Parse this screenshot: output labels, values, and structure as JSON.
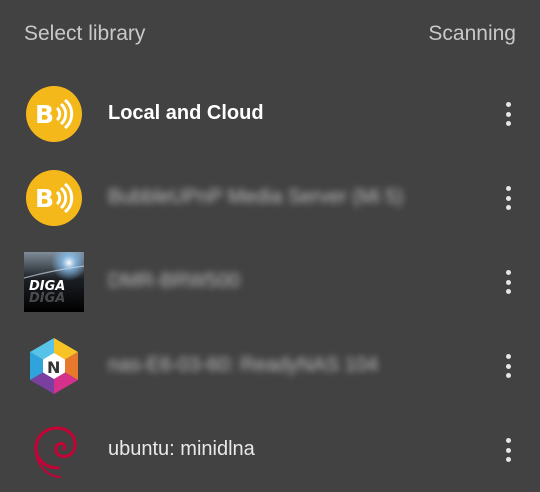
{
  "header": {
    "title": "Select library",
    "status": "Scanning"
  },
  "libraries": [
    {
      "label": "Local and Cloud",
      "icon": "bubbleupnp-icon",
      "style": "bold"
    },
    {
      "label": "BubbleUPnP Media Server (Mi 5)",
      "icon": "bubbleupnp-icon",
      "style": "blurred"
    },
    {
      "label": "DMR-BRW500",
      "icon": "diga-icon",
      "style": "blurred"
    },
    {
      "label": "nas-E6-03-60: ReadyNAS 104",
      "icon": "readynas-icon",
      "style": "blurred"
    },
    {
      "label": "ubuntu: minidlna",
      "icon": "debian-swirl-icon",
      "style": "normal"
    }
  ],
  "colors": {
    "background": "#424242",
    "bubble_yellow": "#F5B81B",
    "debian_red": "#C70036"
  }
}
